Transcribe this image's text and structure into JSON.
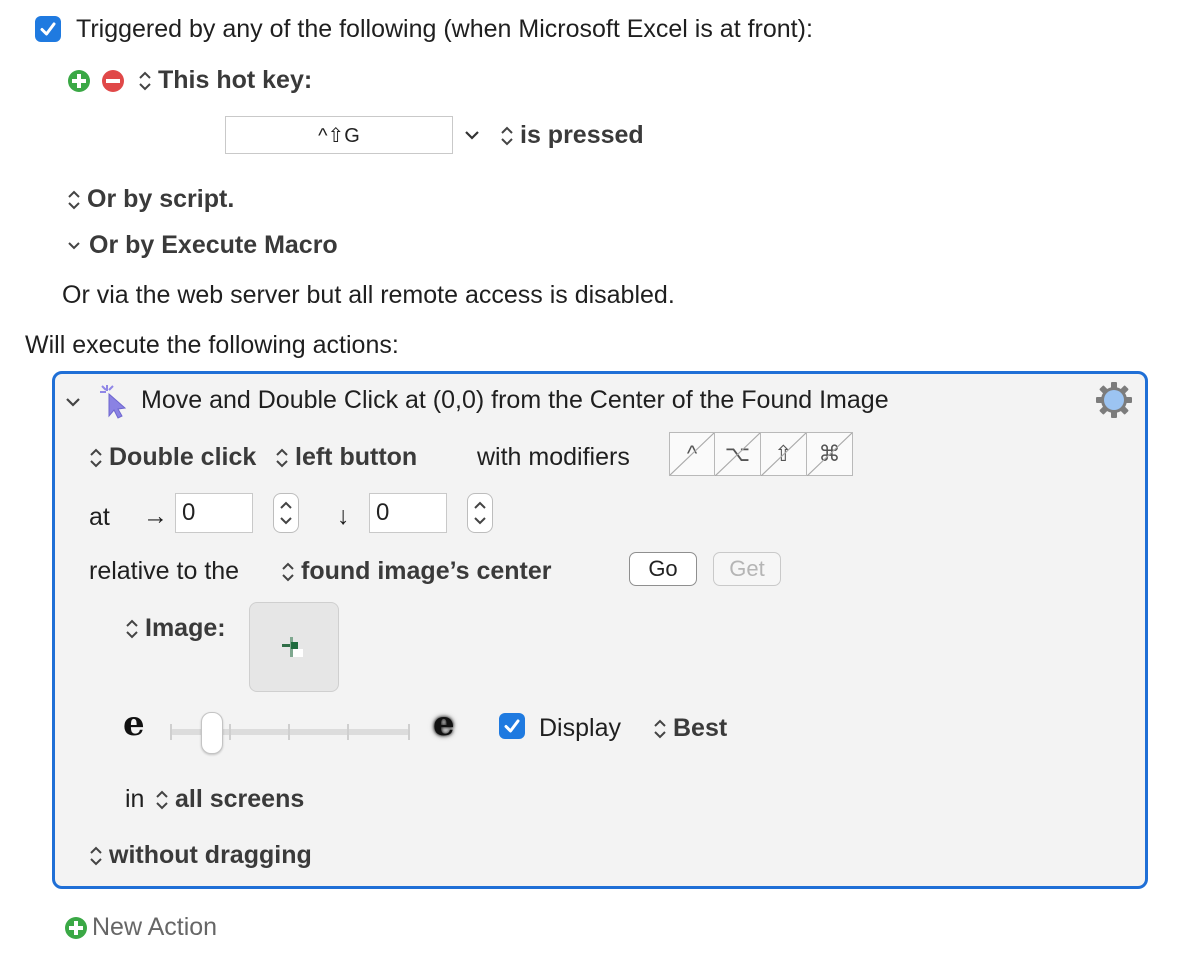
{
  "trigger": {
    "header": "Triggered by any of the following (when Microsoft Excel is at front):",
    "hotkey_label": "This hot key:",
    "hotkey_value": "^⇧G",
    "hotkey_state": "is pressed",
    "by_script": "Or by script.",
    "by_execute_macro": "Or by Execute Macro",
    "web_server": "Or via the web server but all remote access is disabled."
  },
  "actions_header": "Will execute the following actions:",
  "action": {
    "title": "Move and Double Click at (0,0) from the Center of the Found Image",
    "click_type": "Double click",
    "button": "left button",
    "with_modifiers": "with modifiers",
    "modifiers": [
      "^",
      "⌥",
      "⇧",
      "⌘"
    ],
    "at_label": "at",
    "right_arrow": "→",
    "down_arrow": "↓",
    "x_value": "0",
    "y_value": "0",
    "relative_label": "relative to the",
    "relative_value": "found image’s center",
    "go_label": "Go",
    "get_label": "Get",
    "image_label": "Image:",
    "fuzz_low": "e",
    "fuzz_high": "e",
    "fuzziness": 0.17,
    "display_label": "Display",
    "best_label": "Best",
    "in_label": "in",
    "screens_value": "all screens",
    "dragging_value": "without dragging"
  },
  "new_action_label": "New Action",
  "colors": {
    "accent": "#1f6fd6",
    "checkbox": "#1f7ae0",
    "add_green": "#3aa845",
    "remove_red": "#e04848"
  }
}
